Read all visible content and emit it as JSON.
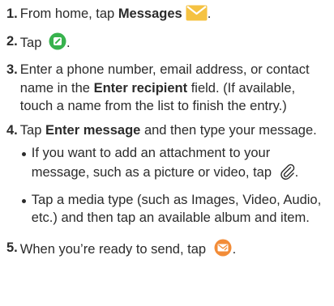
{
  "steps": [
    {
      "num": "1.",
      "before": "From home, tap ",
      "bold": "Messages",
      "after": ".",
      "icon": "messages-envelope-icon"
    },
    {
      "num": "2.",
      "before": "Tap ",
      "after": ".",
      "icon": "compose-icon"
    },
    {
      "num": "3.",
      "before": "Enter a phone number, email address, or contact name in the ",
      "bold": "Enter recipient",
      "after": " field. (If available, touch a name from the list to finish the entry.)"
    },
    {
      "num": "4.",
      "before": "Tap ",
      "bold": "Enter message",
      "after": " and then type your message."
    },
    {
      "num": "5.",
      "before": "When you’re ready to send, tap ",
      "after": ".",
      "icon": "send-icon"
    }
  ],
  "bullets": [
    {
      "before": "If you want to add an attachment to your message, such as a picture or video, tap ",
      "after": ".",
      "icon": "paperclip-icon"
    },
    {
      "text": "Tap a media type (such as Images, Video, Audio, etc.) and then tap an available album and item."
    }
  ],
  "colors": {
    "text": "#2b2b2b",
    "messages_icon": "#f5c242",
    "compose_icon": "#37b24d",
    "send_icon": "#f28c38"
  }
}
